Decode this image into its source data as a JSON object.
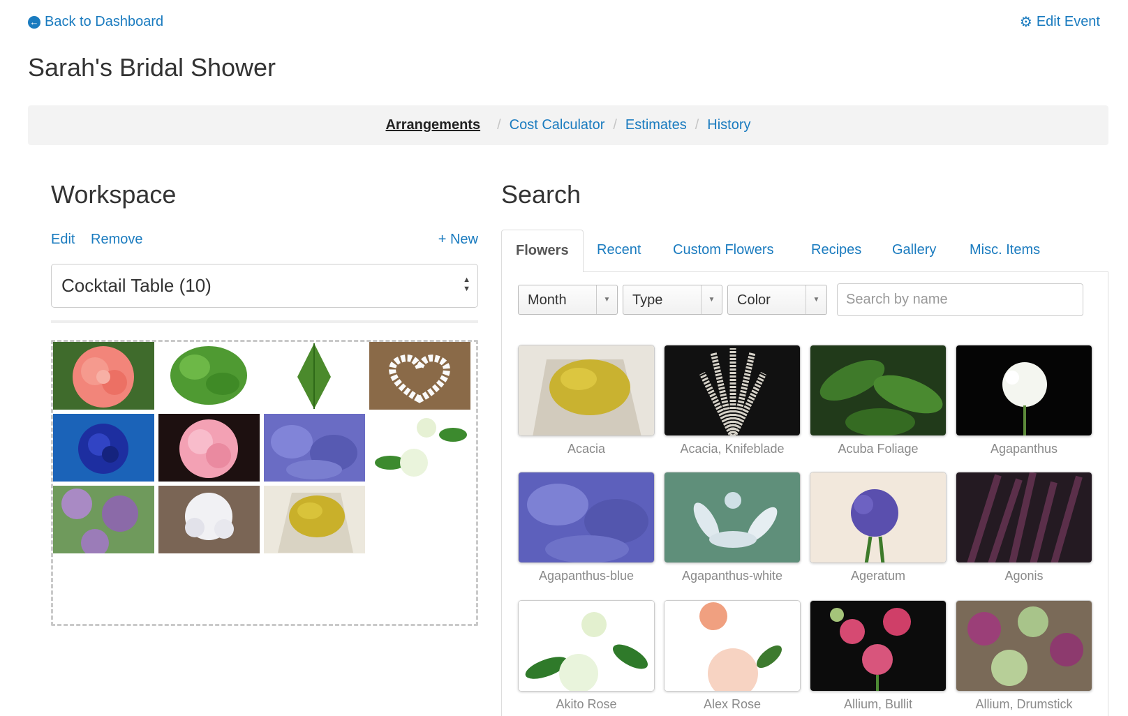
{
  "header": {
    "back_label": "Back to Dashboard",
    "edit_label": "Edit Event",
    "title": "Sarah's Bridal Shower"
  },
  "nav": {
    "items": [
      "Arrangements",
      "Cost Calculator",
      "Estimates",
      "History"
    ],
    "active": "Arrangements",
    "separator": "/"
  },
  "workspace": {
    "title": "Workspace",
    "edit_label": "Edit",
    "remove_label": "Remove",
    "new_label": "+ New",
    "selected_arrangement": "Cocktail Table (10)"
  },
  "search": {
    "title": "Search",
    "tabs": [
      "Flowers",
      "Recent",
      "Custom Flowers",
      "Recipes",
      "Gallery",
      "Misc. Items"
    ],
    "active_tab": "Flowers",
    "filters": {
      "month": "Month",
      "type": "Type",
      "color": "Color"
    },
    "placeholder": "Search by name",
    "results": [
      "Acacia",
      "Acacia, Knifeblade",
      "Acuba Foliage",
      "Agapanthus",
      "Agapanthus-blue",
      "Agapanthus-white",
      "Ageratum",
      "Agonis",
      "Akito Rose",
      "Alex Rose",
      "Allium, Bullit",
      "Allium, Drumstick"
    ]
  },
  "colors": {
    "link": "#1a7bbf",
    "nav_bg": "#f3f3f3",
    "muted_label": "#8a8a8a"
  }
}
